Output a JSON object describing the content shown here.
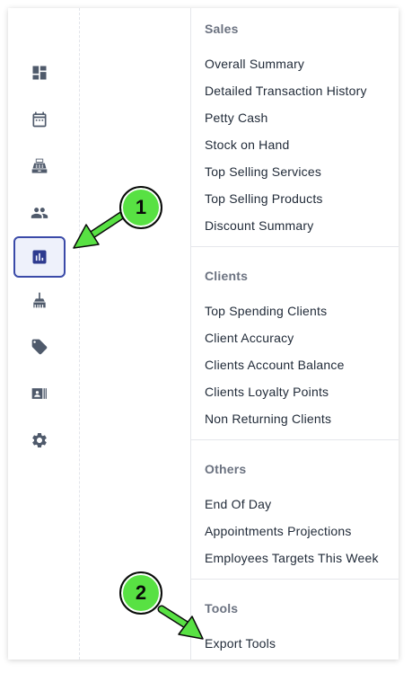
{
  "sidebar": {
    "items": [
      {
        "icon": "dashboard-icon",
        "active": false
      },
      {
        "icon": "calendar-icon",
        "active": false
      },
      {
        "icon": "cash-register-icon",
        "active": false
      },
      {
        "icon": "people-icon",
        "active": false
      },
      {
        "icon": "reports-chart-icon",
        "active": true
      },
      {
        "icon": "broom-icon",
        "active": false
      },
      {
        "icon": "tag-icon",
        "active": false
      },
      {
        "icon": "contact-card-icon",
        "active": false
      },
      {
        "icon": "gear-icon",
        "active": false
      }
    ],
    "active_color": "#3a4aa8"
  },
  "menu": {
    "sales": {
      "title": "Sales",
      "items": [
        "Overall Summary",
        "Detailed Transaction History",
        "Petty Cash",
        "Stock on Hand",
        "Top Selling Services",
        "Top Selling Products",
        "Discount Summary"
      ]
    },
    "clients": {
      "title": "Clients",
      "items": [
        "Top Spending Clients",
        "Client Accuracy",
        "Clients Account Balance",
        "Clients Loyalty Points",
        "Non Returning Clients"
      ]
    },
    "others": {
      "title": "Others",
      "items": [
        "End Of Day",
        "Appointments Projections",
        "Employees Targets This Week"
      ]
    },
    "tools": {
      "title": "Tools",
      "items": [
        "Export Tools"
      ]
    }
  },
  "callouts": {
    "first": "1",
    "second": "2",
    "color": "#58e143"
  }
}
